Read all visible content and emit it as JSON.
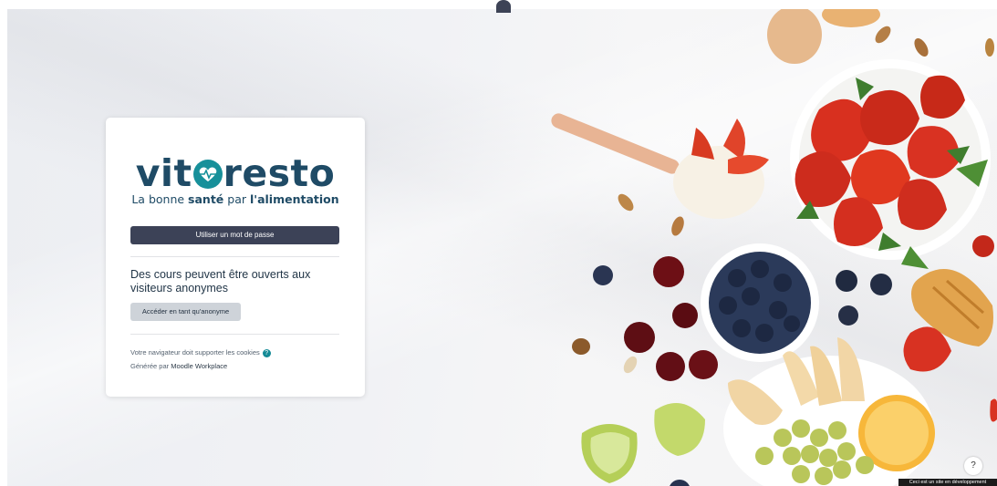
{
  "brand": {
    "logo_left": "vit",
    "logo_right": "resto",
    "tagline_prefix": "La bonne ",
    "tagline_bold1": "santé",
    "tagline_mid": " par ",
    "tagline_bold2": "l'alimentation",
    "colors": {
      "navy": "#1f4b66",
      "teal": "#17909a"
    }
  },
  "login": {
    "password_button": "Utiliser un mot de passe",
    "guest_heading": "Des cours peuvent être ouverts aux visiteurs anonymes",
    "guest_button": "Accéder en tant qu'anonyme",
    "cookies_note": "Votre navigateur doit supporter les cookies",
    "generated_by": "Générée par ",
    "moodle_link": "Moodle Workplace"
  },
  "help_button": "?",
  "dev_banner": "Ceci est un site en développement"
}
